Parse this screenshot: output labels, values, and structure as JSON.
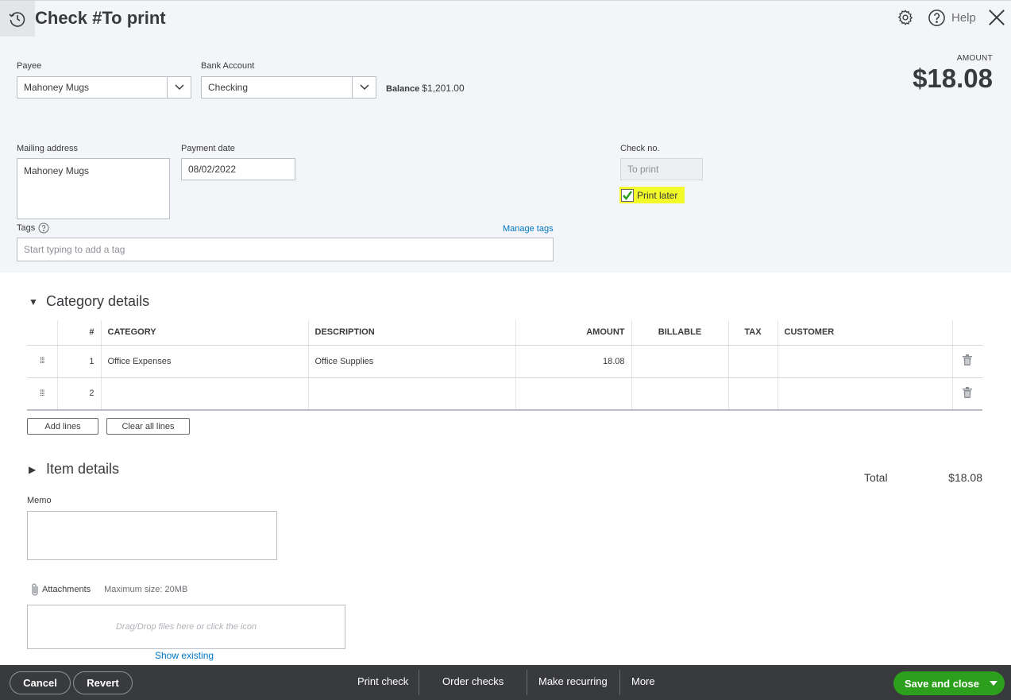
{
  "header": {
    "title": "Check #To print",
    "help_label": "Help"
  },
  "form": {
    "payee_label": "Payee",
    "payee_value": "Mahoney Mugs",
    "bank_account_label": "Bank Account",
    "bank_account_value": "Checking",
    "balance_label": "Balance",
    "balance_value": "$1,201.00",
    "amount_label": "AMOUNT",
    "amount_value": "$18.08",
    "mailing_address_label": "Mailing address",
    "mailing_address_value": "Mahoney Mugs",
    "payment_date_label": "Payment date",
    "payment_date_value": "08/02/2022",
    "check_no_label": "Check no.",
    "check_no_value": "To print",
    "print_later_label": "Print later",
    "print_later_checked": true,
    "tags_label": "Tags",
    "tags_placeholder": "Start typing to add a tag",
    "manage_tags_label": "Manage tags"
  },
  "category_details": {
    "title": "Category details",
    "columns": [
      "#",
      "CATEGORY",
      "DESCRIPTION",
      "AMOUNT",
      "BILLABLE",
      "TAX",
      "CUSTOMER"
    ],
    "rows": [
      {
        "num": "1",
        "category": "Office Expenses",
        "description": "Office Supplies",
        "amount": "18.08",
        "billable": "",
        "tax": "",
        "customer": ""
      },
      {
        "num": "2",
        "category": "",
        "description": "",
        "amount": "",
        "billable": "",
        "tax": "",
        "customer": ""
      }
    ],
    "add_lines_label": "Add lines",
    "clear_all_lines_label": "Clear all lines"
  },
  "item_details": {
    "title": "Item details"
  },
  "totals": {
    "total_label": "Total",
    "total_value": "$18.08"
  },
  "memo": {
    "label": "Memo",
    "value": ""
  },
  "attachments": {
    "label": "Attachments",
    "max_size": "Maximum size: 20MB",
    "drop_text": "Drag/Drop files here or click the icon",
    "show_existing_label": "Show existing"
  },
  "footer": {
    "cancel_label": "Cancel",
    "revert_label": "Revert",
    "print_check_label": "Print check",
    "order_checks_label": "Order checks",
    "make_recurring_label": "Make recurring",
    "more_label": "More",
    "save_close_label": "Save and close"
  },
  "colors": {
    "highlight": "#f2fa29",
    "primary_green": "#2ca01c",
    "link_blue": "#0077c5",
    "footer_bg": "#393a3d"
  }
}
